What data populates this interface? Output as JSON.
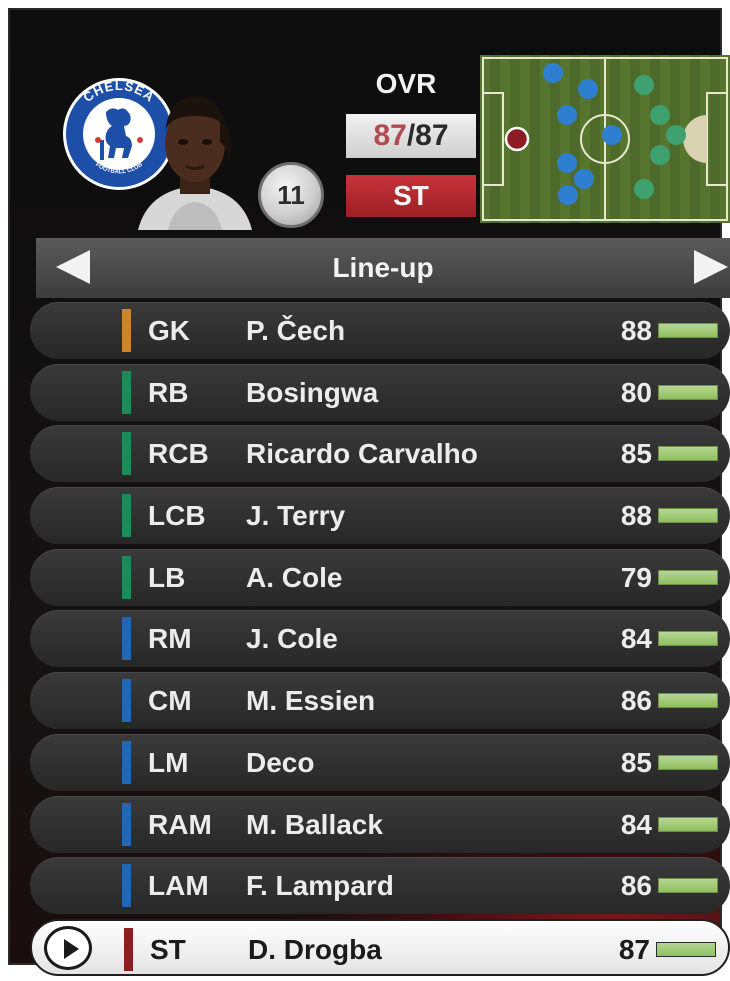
{
  "header": {
    "club_name": "CHELSEA",
    "club_subtitle": "FOOTBALL CLUB",
    "shirt_number": "11",
    "ovr_label": "OVR",
    "ovr_current": "87",
    "ovr_separator": "/",
    "ovr_max": "87",
    "position": "ST"
  },
  "colors": {
    "goalkeeper": "#c8882a",
    "defender": "#1e8a5a",
    "midfielder": "#2566b0",
    "forward": "#8c1d22",
    "rating_bar": "#9cc96a",
    "position_badge": "#b3282e"
  },
  "lineup": {
    "title": "Line-up",
    "prev_icon": "left-arrow-icon",
    "next_icon": "right-arrow-icon",
    "players": [
      {
        "pos": "GK",
        "name": "P. Čech",
        "rating": "88",
        "group": "goalkeeper"
      },
      {
        "pos": "RB",
        "name": "Bosingwa",
        "rating": "80",
        "group": "defender"
      },
      {
        "pos": "RCB",
        "name": "Ricardo Carvalho",
        "rating": "85",
        "group": "defender"
      },
      {
        "pos": "LCB",
        "name": "J. Terry",
        "rating": "88",
        "group": "defender"
      },
      {
        "pos": "LB",
        "name": "A. Cole",
        "rating": "79",
        "group": "defender"
      },
      {
        "pos": "RM",
        "name": "J. Cole",
        "rating": "84",
        "group": "midfielder"
      },
      {
        "pos": "CM",
        "name": "M. Essien",
        "rating": "86",
        "group": "midfielder"
      },
      {
        "pos": "LM",
        "name": "Deco",
        "rating": "85",
        "group": "midfielder"
      },
      {
        "pos": "RAM",
        "name": "M. Ballack",
        "rating": "84",
        "group": "midfielder"
      },
      {
        "pos": "LAM",
        "name": "F. Lampard",
        "rating": "86",
        "group": "midfielder"
      },
      {
        "pos": "ST",
        "name": "D. Drogba",
        "rating": "87",
        "group": "forward",
        "selected": true
      }
    ]
  }
}
